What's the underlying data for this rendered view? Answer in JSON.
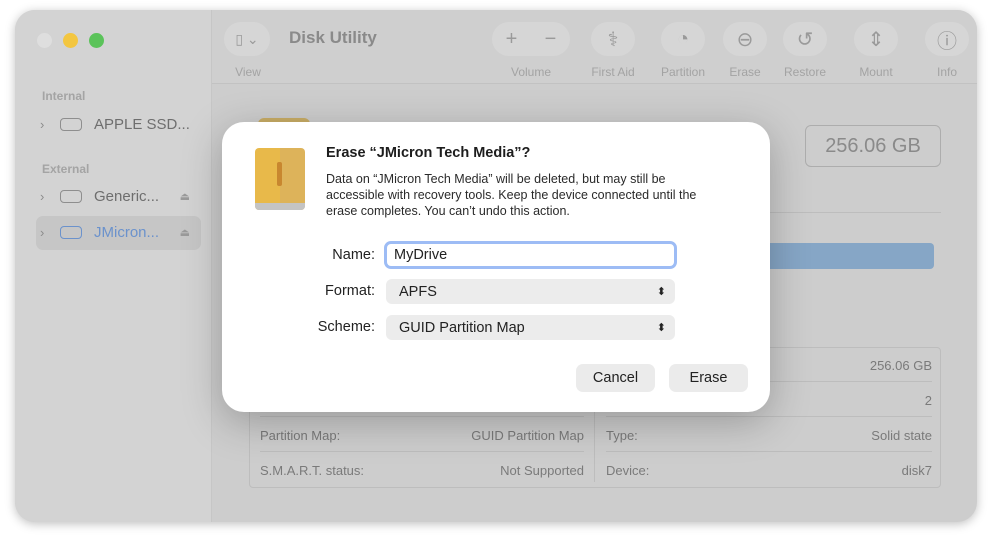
{
  "window": {
    "title": "Disk Utility"
  },
  "toolbar": {
    "view": "View",
    "volume": "Volume",
    "first_aid": "First Aid",
    "partition": "Partition",
    "erase": "Erase",
    "restore": "Restore",
    "mount": "Mount",
    "info": "Info",
    "plus": "+",
    "minus": "−"
  },
  "sidebar": {
    "internal": "Internal",
    "external": "External",
    "items": [
      {
        "label": "APPLE SSD..."
      },
      {
        "label": "Generic..."
      },
      {
        "label": "JMicron..."
      }
    ]
  },
  "main": {
    "capacity": "256.06 GB",
    "info": {
      "r1_value": "256.06 GB",
      "r2_value": "2",
      "partition_map_label": "Partition Map:",
      "partition_map_value": "GUID Partition Map",
      "smart_label": "S.M.A.R.T. status:",
      "smart_value": "Not Supported",
      "type_label": "Type:",
      "type_value": "Solid state",
      "device_label": "Device:",
      "device_value": "disk7"
    }
  },
  "dialog": {
    "title": "Erase “JMicron Tech Media”?",
    "body_lines": [
      "Data on “JMicron Tech Media” will be deleted, but may still be",
      "accessible with recovery tools. Keep the device connected until the",
      "erase completes. You can’t undo this action."
    ],
    "name_label": "Name:",
    "name_value": "MyDrive",
    "format_label": "Format:",
    "format_value": "APFS",
    "scheme_label": "Scheme:",
    "scheme_value": "GUID Partition Map",
    "cancel": "Cancel",
    "erase": "Erase"
  },
  "colors": {
    "accent": "#7aa7f0",
    "selected_text": "#6b92cc",
    "drive_yellow": "#e7b84a"
  }
}
